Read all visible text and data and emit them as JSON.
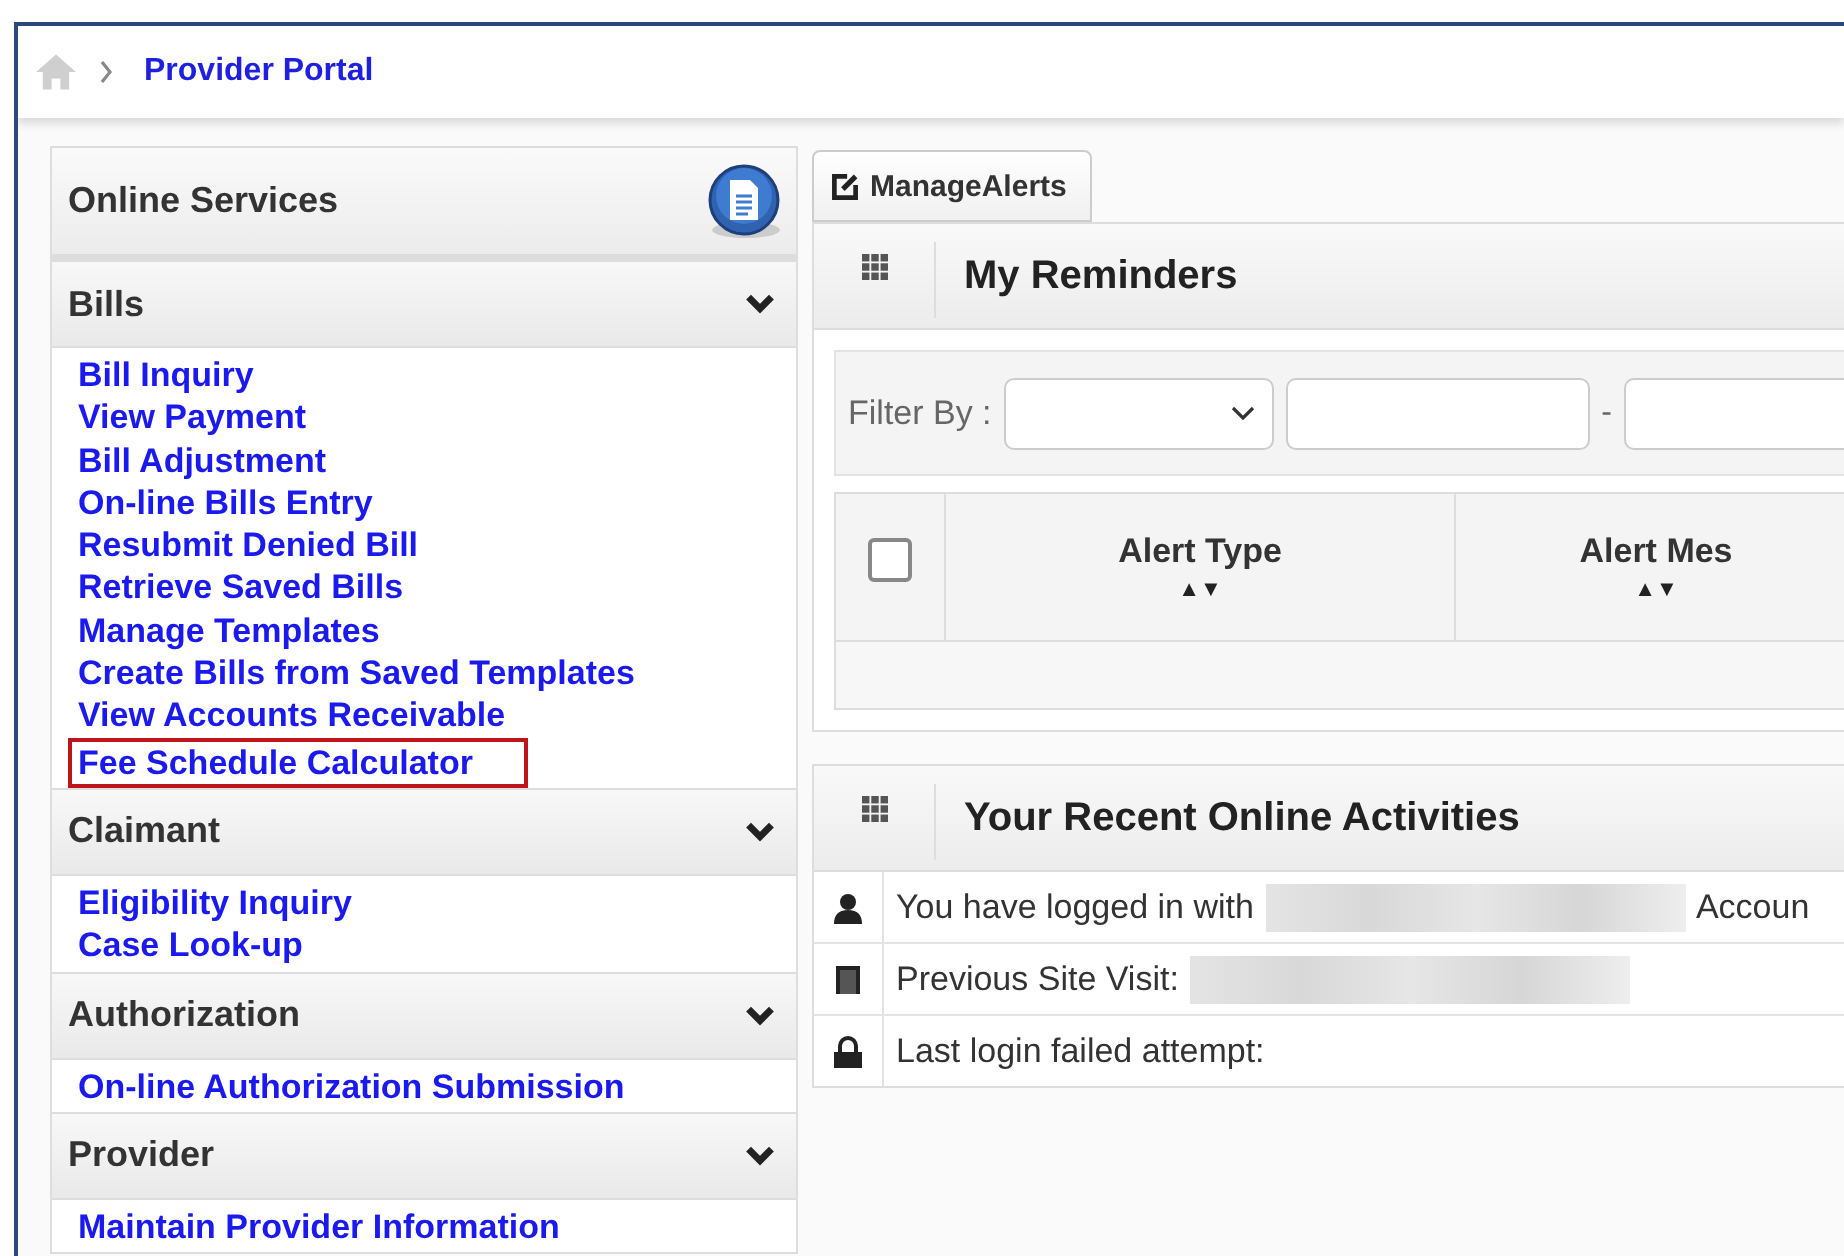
{
  "breadcrumb": {
    "current": "Provider Portal"
  },
  "sidebar": {
    "title": "Online Services",
    "sections": [
      {
        "title": "Bills",
        "expanded": true,
        "links": [
          {
            "label": "Bill Inquiry",
            "highlighted": false
          },
          {
            "label": "View Payment",
            "highlighted": false
          },
          {
            "label": "Bill Adjustment",
            "highlighted": false
          },
          {
            "label": "On-line Bills Entry",
            "highlighted": false
          },
          {
            "label": "Resubmit Denied Bill",
            "highlighted": false
          },
          {
            "label": "Retrieve Saved Bills",
            "highlighted": false
          },
          {
            "label": "Manage Templates",
            "highlighted": false
          },
          {
            "label": "Create Bills from Saved Templates",
            "highlighted": false
          },
          {
            "label": "View Accounts Receivable",
            "highlighted": false
          },
          {
            "label": "Fee Schedule Calculator",
            "highlighted": true
          }
        ]
      },
      {
        "title": "Claimant",
        "expanded": true,
        "links": [
          {
            "label": "Eligibility Inquiry",
            "highlighted": false
          },
          {
            "label": "Case Look-up",
            "highlighted": false
          }
        ]
      },
      {
        "title": "Authorization",
        "expanded": true,
        "links": [
          {
            "label": "On-line Authorization Submission",
            "highlighted": false
          }
        ]
      },
      {
        "title": "Provider",
        "expanded": true,
        "links": [
          {
            "label": "Maintain Provider Information",
            "highlighted": false
          }
        ]
      }
    ]
  },
  "manage_alerts_button": "ManageAlerts",
  "reminders": {
    "title": "My Reminders",
    "filter_label": "Filter By :",
    "range_separator": "-",
    "table": {
      "select_all_checked": false,
      "columns": [
        {
          "label": "Alert Type",
          "sort": "▲▼"
        },
        {
          "label": "Alert Mes",
          "sort": "▲▼"
        }
      ]
    }
  },
  "activities": {
    "title": "Your Recent Online Activities",
    "rows": [
      {
        "text": "You have logged in with",
        "redacted": true,
        "after": "Accoun"
      },
      {
        "text": "Previous Site Visit:",
        "redacted": true
      },
      {
        "text": "Last login failed attempt:",
        "redacted": false
      }
    ]
  }
}
